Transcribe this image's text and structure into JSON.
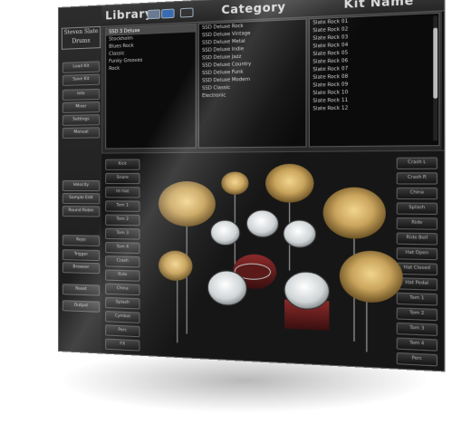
{
  "left_panel": {
    "logo_lines": [
      "Steven Slate",
      "Drums"
    ],
    "buttons": [
      {
        "label": "Load Kit"
      },
      {
        "label": "Save Kit"
      },
      {
        "label": "Info"
      },
      {
        "label": "Mixer"
      },
      {
        "label": "Settings"
      },
      {
        "label": "Manual"
      },
      {
        "label": "Velocity"
      },
      {
        "label": "Sample Edit"
      },
      {
        "label": "Round Robin"
      },
      {
        "label": "Keys"
      },
      {
        "label": "Trigger"
      },
      {
        "label": "Browser"
      },
      {
        "label": "Reset"
      },
      {
        "label": "Output"
      }
    ]
  },
  "header": {
    "library_label": "Library",
    "category_label": "Category",
    "kit_name_label": "Kit Name"
  },
  "library_list": [
    "SSD 3 Deluxe",
    "Stockholm",
    "Blues Rock",
    "Classic",
    "Funky Grooves",
    "Rock"
  ],
  "category_list": [
    "SSD Deluxe Rock",
    "SSD Deluxe Vintage",
    "SSD Deluxe Metal",
    "SSD Deluxe Indie",
    "SSD Deluxe Jazz",
    "SSD Deluxe Country",
    "SSD Deluxe Funk",
    "SSD Deluxe Modern",
    "SSD Classic",
    "Electronic"
  ],
  "kit_list": [
    "Slate Rock 01",
    "Slate Rock 02",
    "Slate Rock 03",
    "Slate Rock 04",
    "Slate Rock 05",
    "Slate Rock 06",
    "Slate Rock 07",
    "Slate Rock 08",
    "Slate Rock 09",
    "Slate Rock 10",
    "Slate Rock 11",
    "Slate Rock 12"
  ],
  "left_pads": [
    "Kick",
    "Snare",
    "Hi Hat",
    "Tom 1",
    "Tom 2",
    "Tom 3",
    "Tom 4",
    "Crash",
    "Ride",
    "China",
    "Splash",
    "Cymbal",
    "Perc",
    "FX"
  ],
  "right_pads": [
    "Crash L",
    "Crash R",
    "China",
    "Splash",
    "Ride",
    "Ride Bell",
    "Hat Open",
    "Hat Closed",
    "Hat Pedal",
    "Tom 1",
    "Tom 2",
    "Tom 3",
    "Tom 4",
    "Perc"
  ],
  "colors": {
    "cymbal": "#c9a45c",
    "drum_head": "#d8dcde",
    "shell": "#6a1f1f"
  }
}
